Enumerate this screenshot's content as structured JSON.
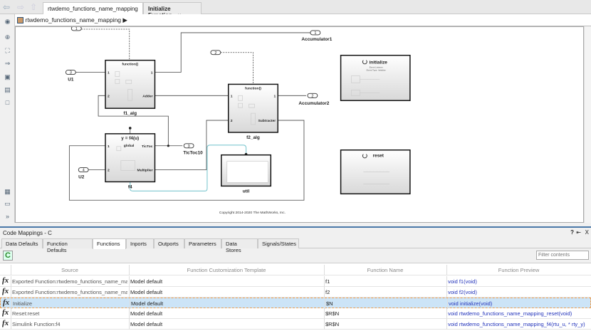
{
  "nav": {
    "back": "⇦",
    "forward": "⇨",
    "up": "⇧"
  },
  "tabs": [
    {
      "label": "rtwdemo_functions_name_mapping",
      "close": "×"
    },
    {
      "label": "Initialize Function",
      "close": "×"
    }
  ],
  "breadcrumb": {
    "model": "rtwdemo_functions_name_mapping",
    "arrow": "▶"
  },
  "diagram": {
    "inports": [
      {
        "num": "1"
      },
      {
        "num": "2"
      },
      {
        "num": "3",
        "label": "U1"
      },
      {
        "num": "4",
        "label": "U2"
      }
    ],
    "outports": [
      {
        "num": "1",
        "label": "Accumulator1"
      },
      {
        "num": "2",
        "label": "Accumulator2"
      },
      {
        "num": "3",
        "label": "TicToc10"
      }
    ],
    "f1": {
      "name": "f1_alg",
      "header": "function()",
      "p1": "1",
      "p2": "2",
      "out1": "1",
      "out2": "Adder"
    },
    "f2": {
      "name": "f2_alg",
      "header": "function()",
      "p1": "1",
      "p2": "2",
      "out1": "1",
      "out2": "Subtracter"
    },
    "f4": {
      "name": "f4",
      "header": "y = f4(u)",
      "global": "global",
      "p1": "1",
      "p2": "2",
      "out1": "TicToc",
      "out2": "Multiplier"
    },
    "util": {
      "name": "util"
    },
    "initialize": {
      "title": "initialize",
      "sub1": "Event Listener",
      "sub2": "Event Type: Initialize"
    },
    "reset": {
      "title": "reset"
    },
    "copyright": "Copyright 2014-2020 The MathWorks, Inc."
  },
  "panel": {
    "title": "Code Mappings - C",
    "help": "?",
    "pin": "⇤",
    "close": "X",
    "tabs": [
      "Data Defaults",
      "Function Defaults",
      "Functions",
      "Inports",
      "Outports",
      "Parameters",
      "Data Stores",
      "Signals/States"
    ],
    "active_tab": "Functions",
    "filter_placeholder": "Filter contents",
    "columns": [
      "Source",
      "Function Customization Template",
      "Function Name",
      "Function Preview"
    ],
    "rows": [
      {
        "source": "Exported Function:rtwdemo_functions_name_map...",
        "template": "Model default",
        "name": "f1",
        "preview": "void f1(void)"
      },
      {
        "source": "Exported Function:rtwdemo_functions_name_map...",
        "template": "Model default",
        "name": "f2",
        "preview": "void f2(void)"
      },
      {
        "source": "Initialize",
        "template": "Model default",
        "name": "$N",
        "preview": "void initialize(void)",
        "selected": true
      },
      {
        "source": "Reset:reset",
        "template": "Model default",
        "name": "$R$N",
        "preview": "void rtwdemo_functions_name_mapping_reset(void)"
      },
      {
        "source": "Simulink Function:f4",
        "template": "Model default",
        "name": "$R$N",
        "preview": "void rtwdemo_functions_name_mapping_f4(rtu_u, * rty_y)"
      }
    ]
  },
  "colors": {
    "accent": "#4a78a8",
    "selection": "#cce4f7",
    "link": "#2233bb",
    "signal_highlight": "#7fc8d0"
  }
}
